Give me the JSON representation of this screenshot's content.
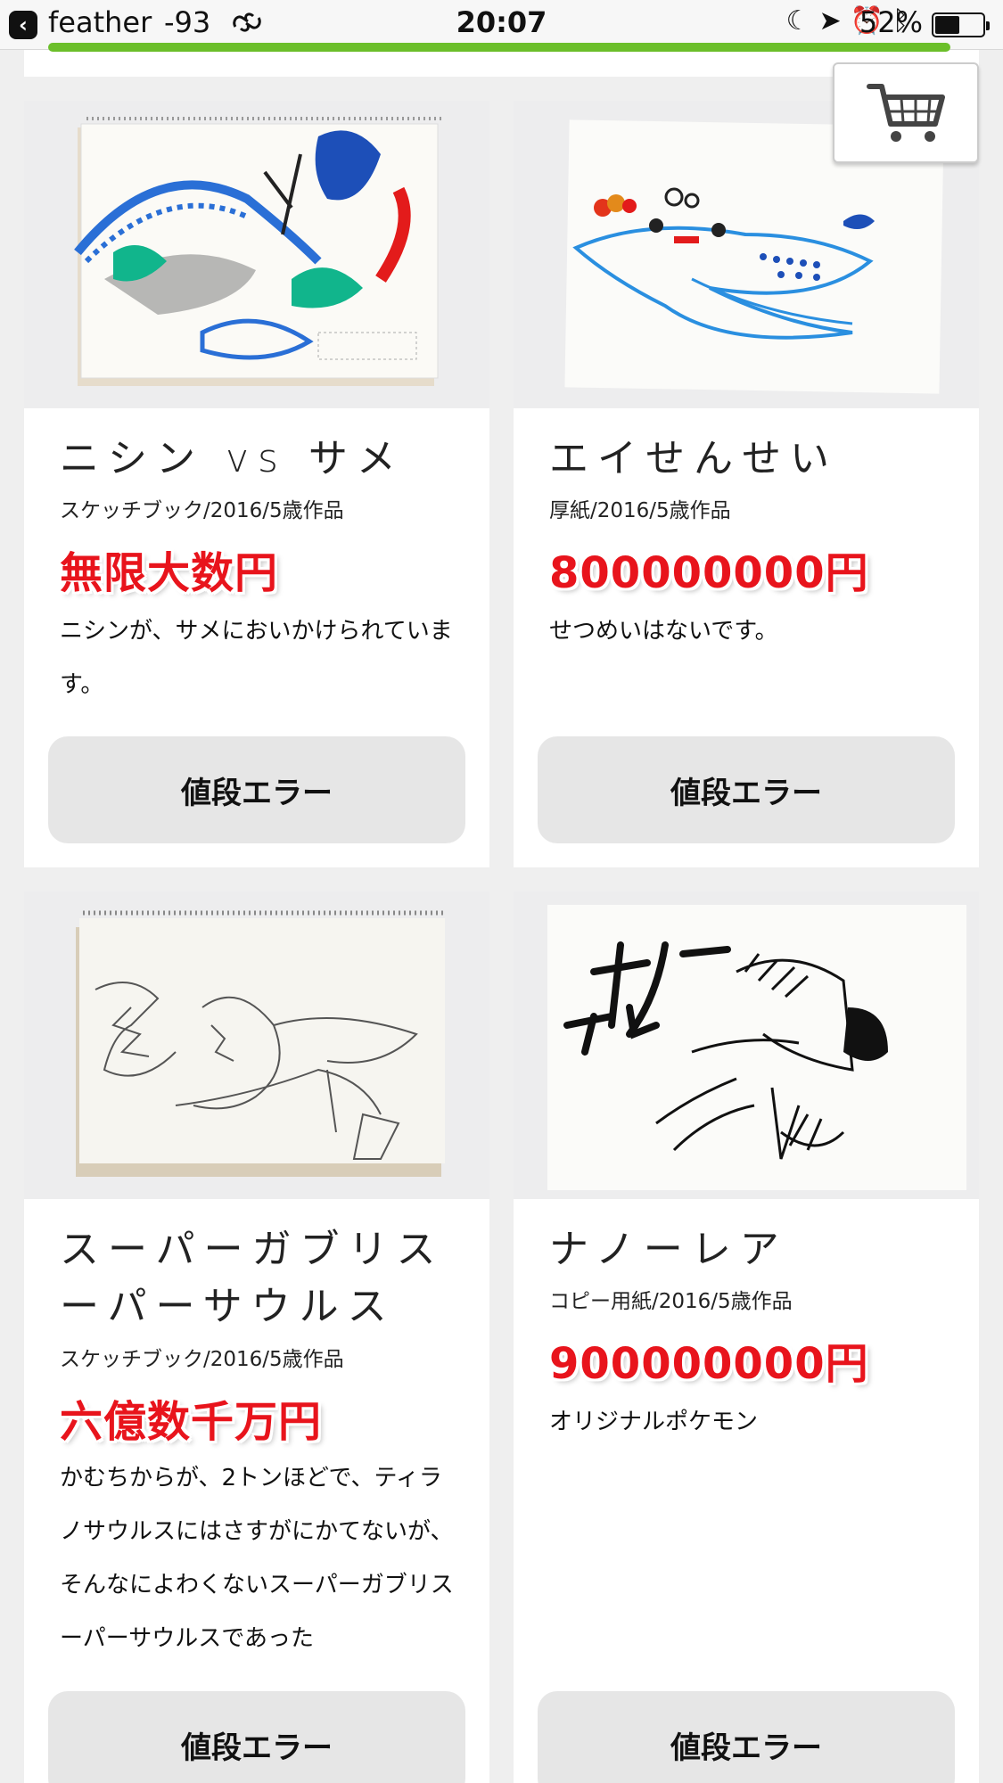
{
  "status_bar": {
    "carrier": "feather",
    "signal": "-93",
    "time": "20:07",
    "battery_percent": "52%",
    "battery_level": 0.52
  },
  "cart": {
    "icon": "cart-icon"
  },
  "products": [
    {
      "title": "ニシン vs サメ",
      "meta": "スケッチブック/2016/5歳作品",
      "price": "無限大数円",
      "description": "ニシンが、サメにおいかけられています。",
      "button_label": "値段エラー"
    },
    {
      "title": "エイせんせい",
      "meta": "厚紙/2016/5歳作品",
      "price": "800000000円",
      "description": "せつめいはないです。",
      "button_label": "値段エラー"
    },
    {
      "title": "スーパーガブリスーパーサウルス",
      "meta": "スケッチブック/2016/5歳作品",
      "price": "六億数千万円",
      "description": "かむちからが、2トンほどで、ティラノサウルスにはさすがにかてないが、そんなによわくないスーパーガブリスーパーサウルスであった",
      "button_label": "値段エラー"
    },
    {
      "title": "ナノーレア",
      "meta": "コピー用紙/2016/5歳作品",
      "price": "900000000円",
      "description": "オリジナルポケモン",
      "button_label": "値段エラー"
    }
  ],
  "colors": {
    "price_red": "#e8141c",
    "accent_green": "#6bbf2a",
    "button_gray": "#e6e6e6"
  }
}
